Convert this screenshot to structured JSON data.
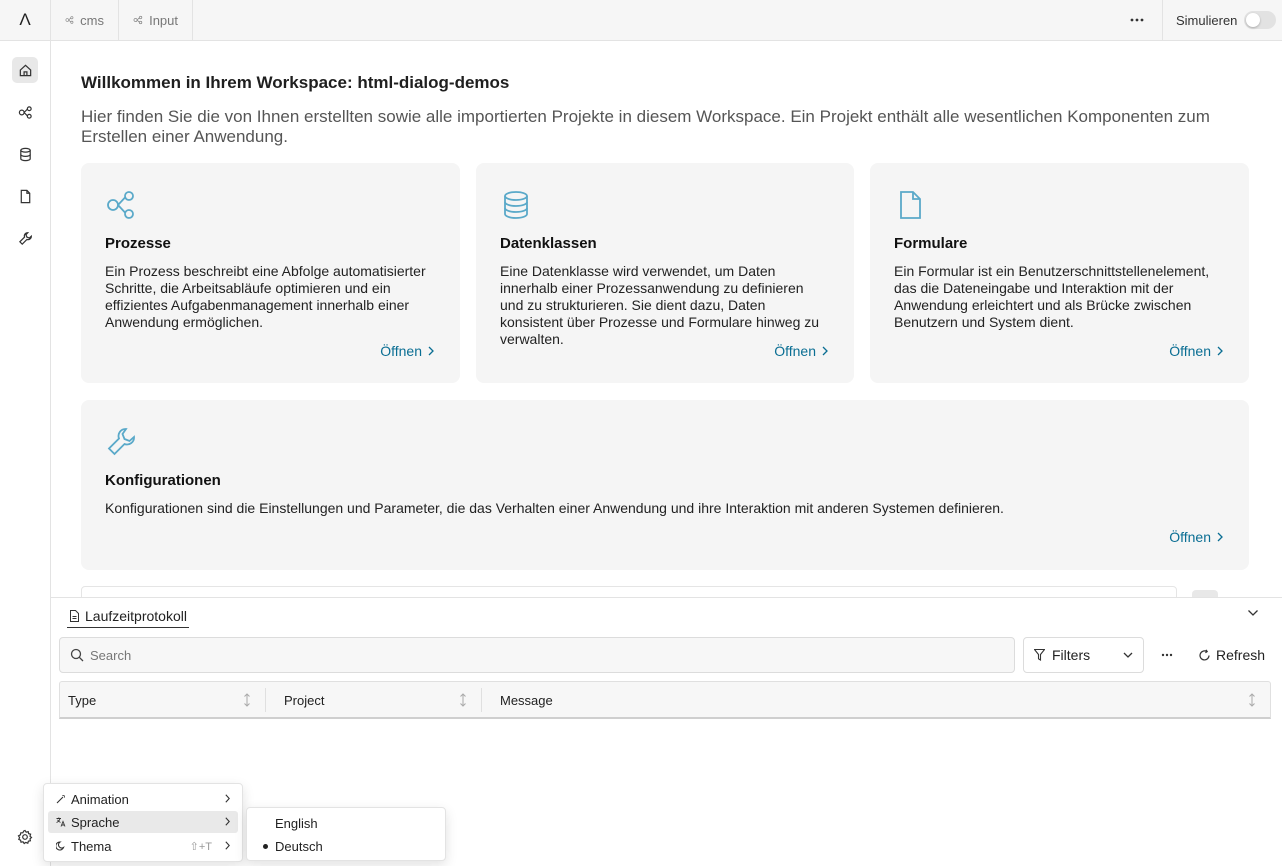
{
  "topbar": {
    "logo_glyph": "Λ",
    "tabs": [
      {
        "label": "cms",
        "icon": "flow-icon"
      },
      {
        "label": "Input",
        "icon": "flow-icon"
      }
    ],
    "more_icon": "ellipsis-icon",
    "simulate_label": "Simulieren",
    "simulate_on": false
  },
  "sidebar": {
    "items": [
      {
        "name": "home",
        "icon": "home-icon",
        "active": true
      },
      {
        "name": "processes",
        "icon": "flow-icon",
        "active": false
      },
      {
        "name": "dataclasses",
        "icon": "database-icon",
        "active": false
      },
      {
        "name": "forms",
        "icon": "file-icon",
        "active": false
      },
      {
        "name": "configurations",
        "icon": "wrench-icon",
        "active": false
      }
    ],
    "settings_icon": "gear-icon"
  },
  "main": {
    "title": "Willkommen in Ihrem Workspace: html-dialog-demos",
    "intro": "Hier finden Sie die von Ihnen erstellten sowie alle importierten Projekte in diesem Workspace. Ein Projekt enthält alle wesentlichen Komponenten zum Erstellen einer Anwendung.",
    "cards": [
      {
        "title": "Prozesse",
        "icon": "flow-icon",
        "description": "Ein Prozess beschreibt eine Abfolge automatisierter Schritte, die Arbeitsabläufe optimieren und ein effizientes Aufgabenmanagement innerhalb einer Anwendung ermöglichen.",
        "open_label": "Öffnen"
      },
      {
        "title": "Datenklassen",
        "icon": "database-icon",
        "description": "Eine Datenklasse wird verwendet, um Daten innerhalb einer Prozessanwendung zu definieren und zu strukturieren. Sie dient dazu, Daten konsistent über Prozesse und Formulare hinweg zu verwalten.",
        "open_label": "Öffnen"
      },
      {
        "title": "Formulare",
        "icon": "file-icon",
        "description": "Ein Formular ist ein Benutzerschnittstellenelement, das die Dateneingabe und Interaktion mit der Anwendung erleichtert und als Brücke zwischen Benutzern und System dient.",
        "open_label": "Öffnen"
      },
      {
        "title": "Konfigurationen",
        "icon": "wrench-icon",
        "description": "Konfigurationen sind die Einstellungen und Parameter, die das Verhalten einer Anwendung und ihre Interaktion mit anderen Systemen definieren.",
        "open_label": "Öffnen"
      }
    ]
  },
  "panel": {
    "tab_label": "Laufzeitprotokoll",
    "search_placeholder": "Search",
    "filters_label": "Filters",
    "refresh_label": "Refresh",
    "columns": [
      "Type",
      "Project",
      "Message"
    ]
  },
  "settings_menu": {
    "items": [
      {
        "label": "Animation",
        "icon": "wand-icon",
        "shortcut": ""
      },
      {
        "label": "Sprache",
        "icon": "translate-icon",
        "shortcut": "",
        "highlighted": true
      },
      {
        "label": "Thema",
        "icon": "moon-icon",
        "shortcut": "⇧+T"
      }
    ]
  },
  "language_submenu": {
    "items": [
      {
        "label": "English",
        "selected": false
      },
      {
        "label": "Deutsch",
        "selected": true
      }
    ]
  },
  "colors": {
    "accent_link": "#0a6e93",
    "icon_blue": "#5aa9c9",
    "card_bg": "#f5f5f5"
  }
}
